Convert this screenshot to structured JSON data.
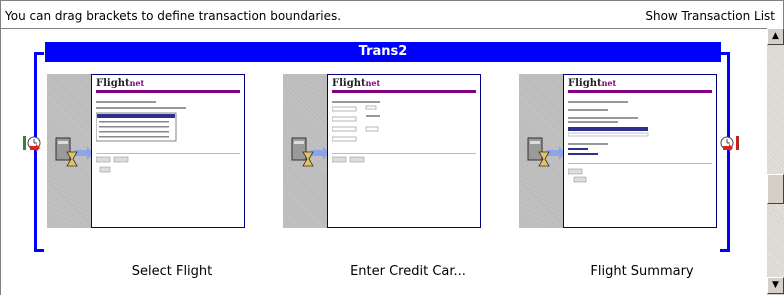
{
  "header": {
    "message": "You can drag brackets to define transaction boundaries.",
    "show_list_label": "Show Transaction List"
  },
  "transaction": {
    "name": "Trans2"
  },
  "steps": [
    {
      "label": "Select Flight",
      "logo_main": "Flight",
      "logo_sub": "net"
    },
    {
      "label": "Enter Credit Car...",
      "logo_main": "Flight",
      "logo_sub": "net"
    },
    {
      "label": "Flight Summary",
      "logo_main": "Flight",
      "logo_sub": "net"
    }
  ],
  "icons": {
    "server": "server-icon",
    "arrow": "arrow-right-icon",
    "hourglass": "hourglass-icon",
    "start": "transaction-start-icon",
    "end": "transaction-end-icon"
  },
  "colors": {
    "bracket": "#0000ff",
    "accent": "#800080",
    "thumb_border": "#000080"
  }
}
